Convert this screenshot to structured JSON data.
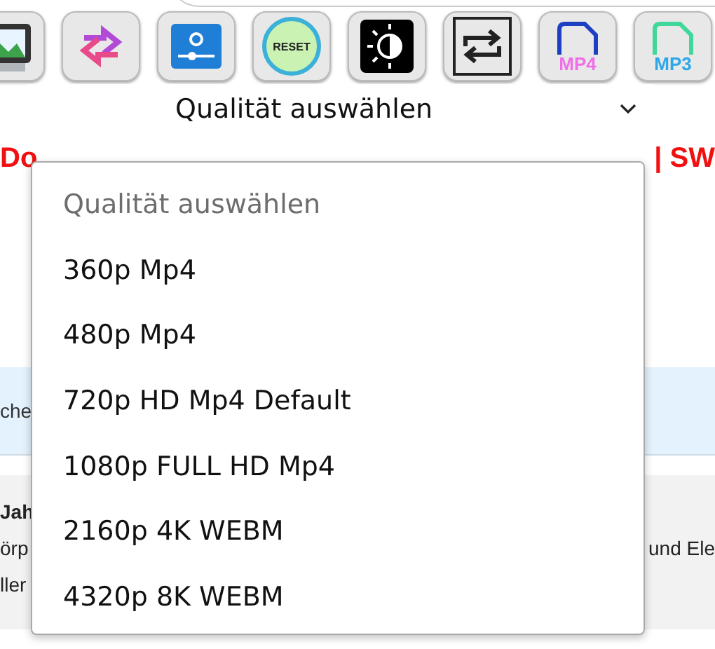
{
  "toolbar": [
    {
      "kind": "image"
    },
    {
      "kind": "swap"
    },
    {
      "kind": "video"
    },
    {
      "kind": "reset",
      "label": "RESET"
    },
    {
      "kind": "brightness"
    },
    {
      "kind": "repeat"
    },
    {
      "kind": "mp4",
      "label": "MP4"
    },
    {
      "kind": "mp3",
      "label": "MP3"
    }
  ],
  "quality_select": {
    "value": "Qualität auswählen",
    "expanded": true,
    "options": [
      {
        "label": "Qualität auswählen",
        "disabled": true
      },
      {
        "label": "360p Mp4",
        "disabled": false
      },
      {
        "label": "480p Mp4",
        "disabled": false
      },
      {
        "label": "720p HD Mp4 Default",
        "disabled": false
      },
      {
        "label": "1080p FULL HD Mp4",
        "disabled": false
      },
      {
        "label": "2160p 4K WEBM",
        "disabled": false
      },
      {
        "label": "4320p 8K WEBM",
        "disabled": false
      }
    ]
  },
  "heading_left": "Do",
  "heading_right": "| SW",
  "notice_left": "che",
  "footer": {
    "title_left": "Jah",
    "line_2_left": "örp",
    "line_2_right": "und Ele",
    "line_3_left": "ller"
  }
}
